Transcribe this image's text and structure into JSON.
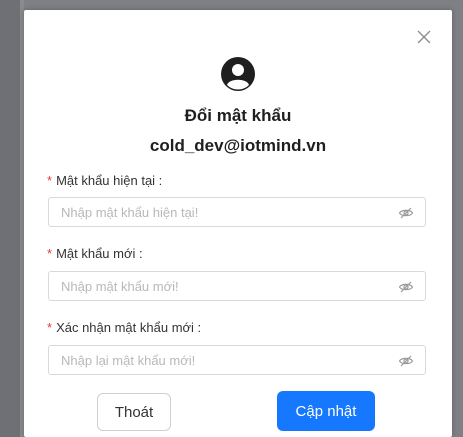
{
  "modal": {
    "title": "Đổi mật khẩu",
    "email": "cold_dev@iotmind.vn",
    "close_icon": "close-icon",
    "avatar_icon": "user-circle-icon"
  },
  "fields": [
    {
      "label": "Mật khẩu hiện tại :",
      "required_mark": "*",
      "placeholder": "Nhập mật khẩu hiện tại!",
      "value": "",
      "icon": "eye-invisible-icon"
    },
    {
      "label": "Mật khẩu mới :",
      "required_mark": "*",
      "placeholder": "Nhập mật khẩu mới!",
      "value": "",
      "icon": "eye-invisible-icon"
    },
    {
      "label": "Xác nhận mật khẩu mới :",
      "required_mark": "*",
      "placeholder": "Nhập lại mật khẩu mới!",
      "value": "",
      "icon": "eye-invisible-icon"
    }
  ],
  "buttons": {
    "cancel_label": "Thoát",
    "submit_label": "Cập nhật"
  },
  "colors": {
    "primary": "#1677ff",
    "required": "#e53935",
    "overlay": "#7f8085"
  }
}
